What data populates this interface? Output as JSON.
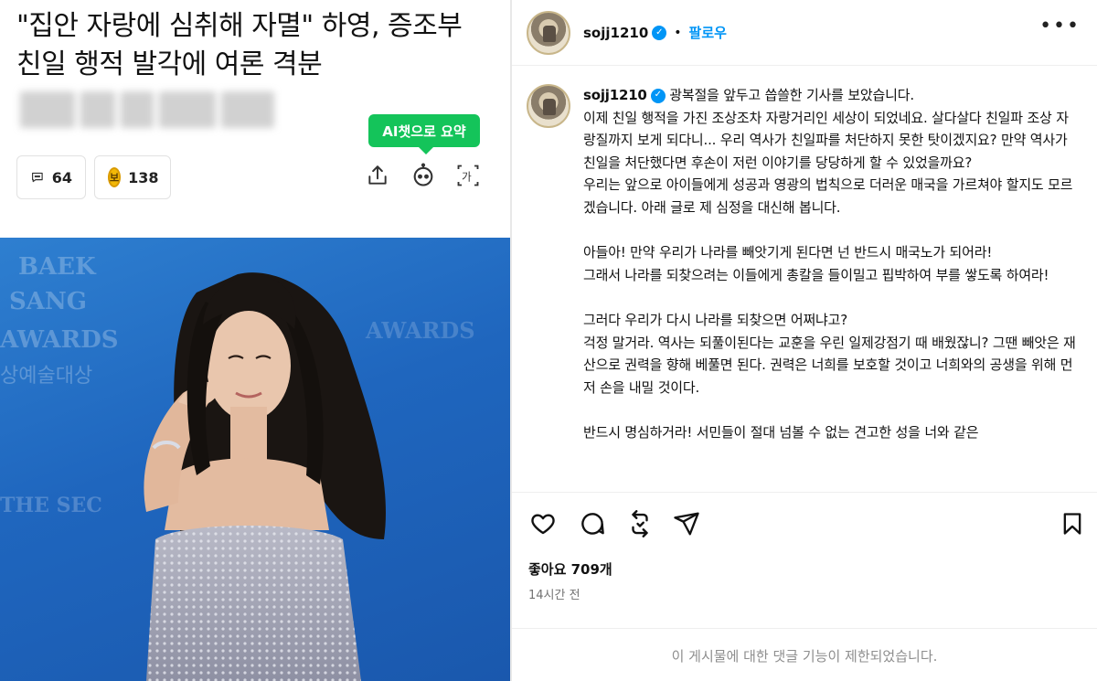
{
  "article": {
    "headline": "\"집안 자랑에 심취해 자멸\" 하영, 증조부 친일 행적 발각에 여론 격분",
    "ai_summary": {
      "highlight": "AI챗",
      "rest": "으로 요약"
    },
    "comment_count": "64",
    "coin_symbol": "보",
    "coin_count": "138",
    "photo_overlay_text": [
      "BAEK",
      "SANG",
      "AWARDS",
      "상예술대상",
      "THE SEC"
    ]
  },
  "instagram": {
    "username": "sojj1210",
    "follow_label": "팔로우",
    "dot": "•",
    "caption_user": "sojj1210",
    "caption": " 광복절을 앞두고 씁쓸한 기사를 보았습니다.\n이제 친일 행적을 가진 조상조차 자랑거리인 세상이 되었네요. 살다살다 친일파 조상 자랑질까지 보게 되다니... 우리 역사가 친일파를 처단하지 못한 탓이겠지요? 만약 역사가 친일을 처단했다면 후손이 저런 이야기를 당당하게 할 수 있었을까요?\n우리는 앞으로 아이들에게 성공과 영광의 법칙으로 더러운 매국을 가르쳐야 할지도 모르겠습니다. 아래 글로 제 심정을 대신해 봅니다.\n\n아들아! 만약 우리가 나라를 빼앗기게 된다면 넌 반드시 매국노가 되어라!\n그래서 나라를 되찾으려는 이들에게 총칼을 들이밀고 핍박하여 부를 쌓도록 하여라!\n\n그러다 우리가 다시 나라를 되찾으면 어쩌냐고?\n걱정 말거라. 역사는 되풀이된다는 교훈을 우린 일제강점기 때 배웠잖니? 그땐 빼앗은 재산으로 권력을 향해 베풀면 된다. 권력은 너희를 보호할 것이고 너희와의 공생을 위해 먼저 손을 내밀 것이다.\n\n반드시 명심하거라! 서민들이 절대 넘볼 수 없는 견고한 성을 너와 같은",
    "likes": "좋아요 709개",
    "time": "14시간 전",
    "comments_limited": "이 게시물에 대한 댓글 기능이 제한되었습니다."
  }
}
